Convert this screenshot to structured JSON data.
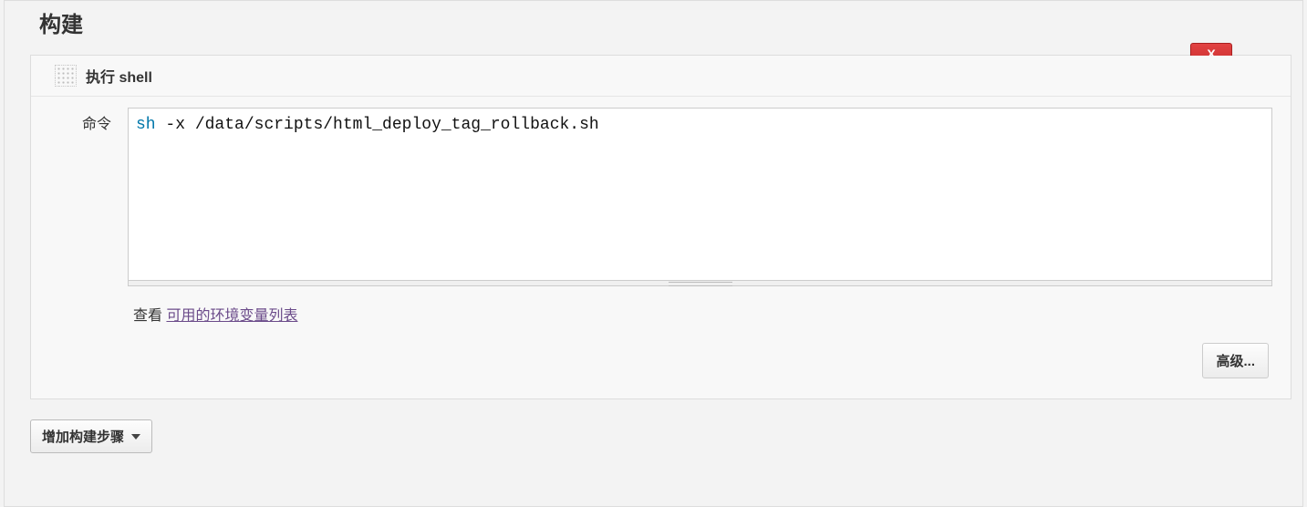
{
  "section": {
    "title": "构建"
  },
  "step": {
    "title": "执行 shell",
    "close_label": "X",
    "command_label": "命令",
    "command_value": "sh -x /data/scripts/html_deploy_tag_rollback.sh",
    "view_prefix": "查看 ",
    "env_link": "可用的环境变量列表",
    "advanced_label": "高级..."
  },
  "add_step": {
    "label": "增加构建步骤"
  }
}
